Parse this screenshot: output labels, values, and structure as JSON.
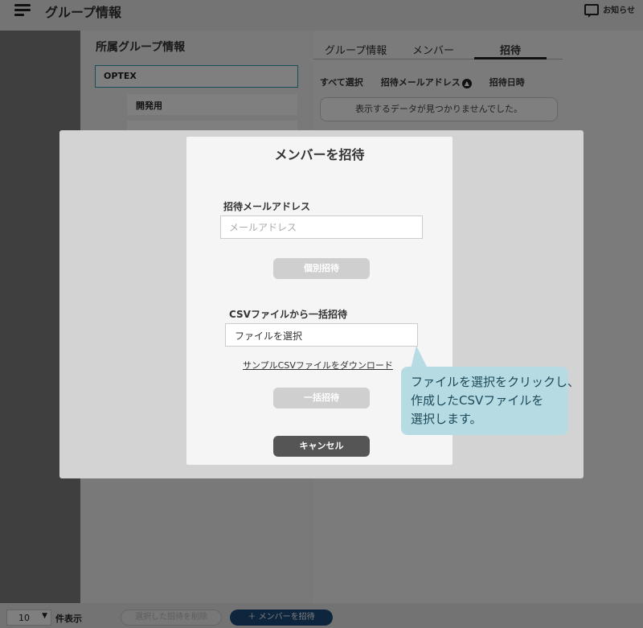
{
  "header": {
    "title": "グループ情報",
    "notice_label": "お知らせ"
  },
  "groups_panel": {
    "title": "所属グループ情報",
    "root_group": "OPTEX",
    "child_groups": [
      "開発用"
    ]
  },
  "tabs": [
    {
      "label": "グループ情報",
      "active": false
    },
    {
      "label": "メンバー",
      "active": false
    },
    {
      "label": "招待",
      "active": true
    }
  ],
  "table": {
    "select_all": "すべて選択",
    "col_email": "招待メールアドレス",
    "col_date": "招待日時",
    "empty_message": "表示するデータが見つかりませんでした。"
  },
  "footer": {
    "per_page_value": "10",
    "per_page_label": "件表示",
    "delete_button": "選択した招待を削除",
    "invite_button": "＋ メンバーを招待"
  },
  "modal": {
    "title": "メンバーを招待",
    "email_label": "招待メールアドレス",
    "email_placeholder": "メールアドレス",
    "individual_button": "個別招待",
    "csv_label": "CSVファイルから一括招待",
    "file_select_label": "ファイルを選択",
    "sample_link": "サンプルCSVファイルをダウンロード",
    "bulk_button": "一括招待",
    "cancel_button": "キャンセル"
  },
  "callout": {
    "lines": [
      "ファイルを選択をクリックし、",
      "作成したCSVファイルを",
      "選択します。"
    ]
  },
  "colors": {
    "callout_bg": "#b7dbe3",
    "primary": "#1a4a7a",
    "accent_border": "#2aa0b0"
  }
}
